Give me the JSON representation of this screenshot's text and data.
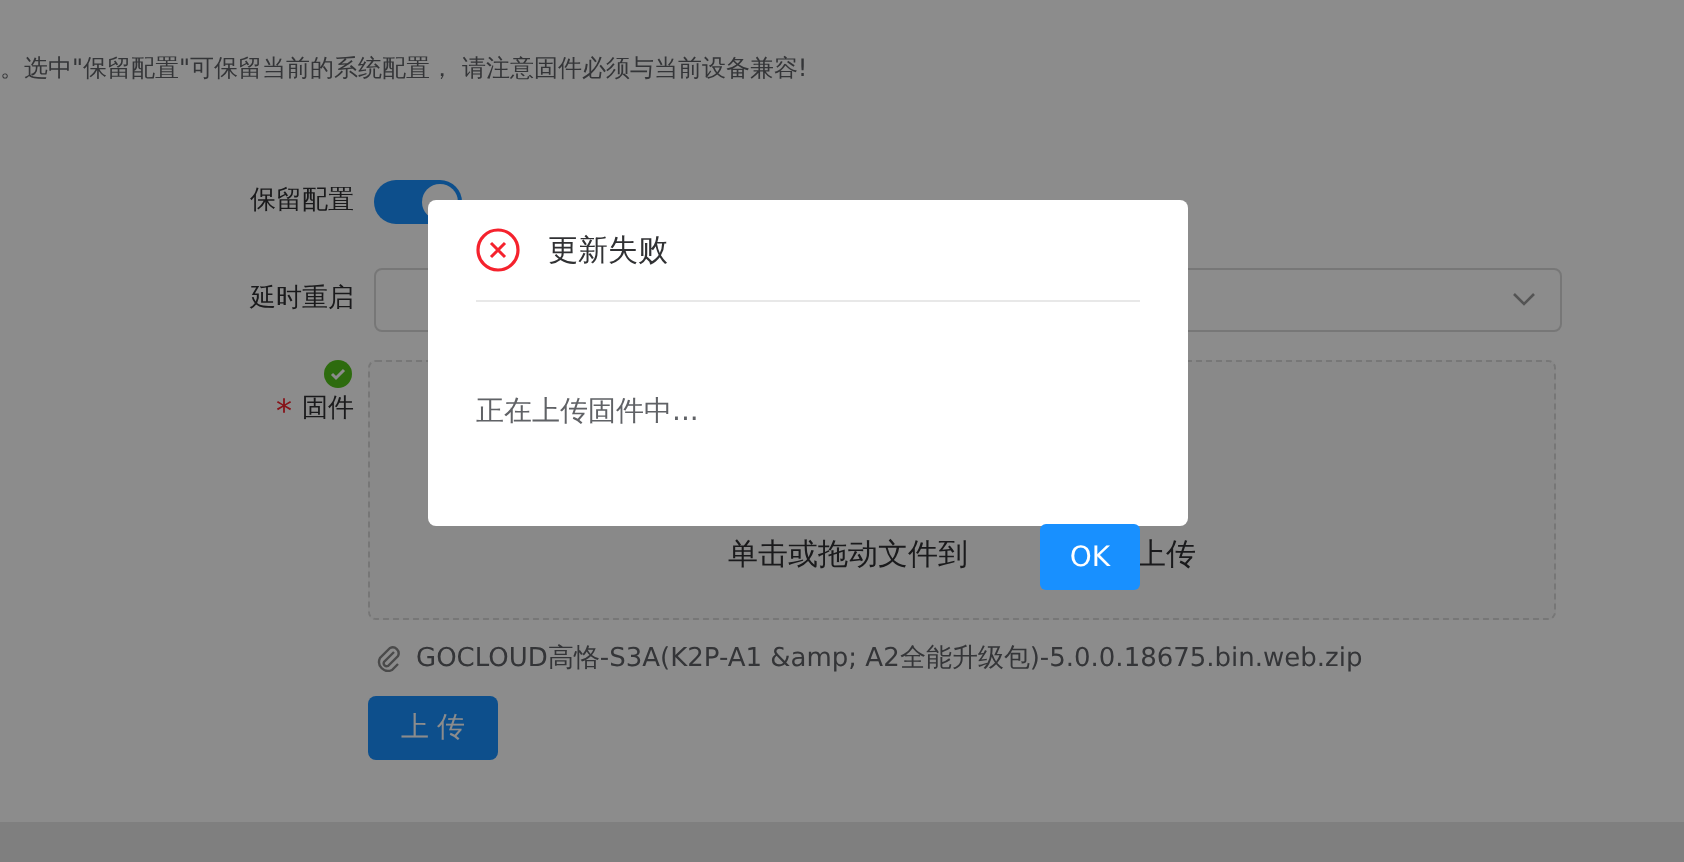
{
  "notice": "。选中\"保留配置\"可保留当前的系统配置， 请注意固件必须与当前设备兼容!",
  "form": {
    "keep_config": {
      "label": "保留配置",
      "on": true
    },
    "delay_reboot": {
      "label": "延时重启"
    },
    "firmware": {
      "required_mark": "*",
      "label": "固件",
      "validated": true,
      "dragger_text_before": "单击或拖动文件到",
      "dragger_text_after": "上传",
      "file": "GOCLOUD高恪-S3A(K2P-A1 &amp; A2全能升级包)-5.0.0.18675.bin.web.zip"
    },
    "upload_button": "上 传"
  },
  "dialog": {
    "title": "更新失败",
    "message": "正在上传固件中...",
    "ok": "OK"
  }
}
